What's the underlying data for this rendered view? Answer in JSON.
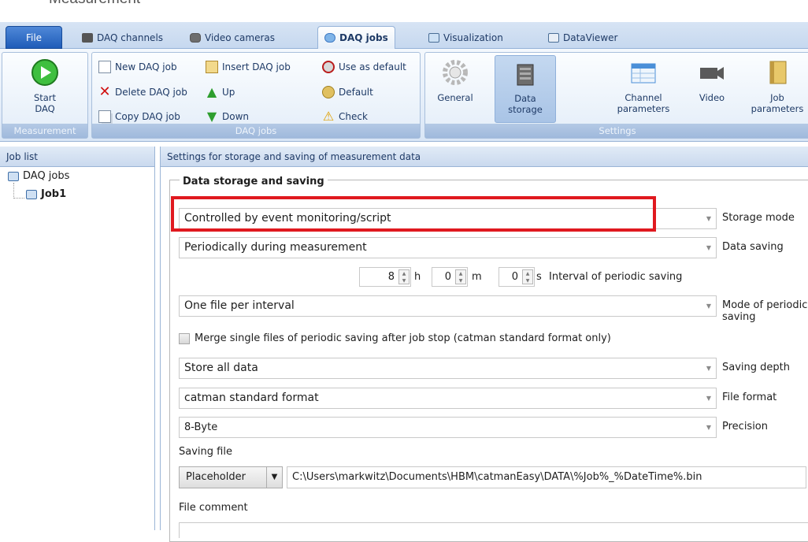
{
  "top_caption": "Measurement",
  "tabs": [
    {
      "label": "File",
      "icon": "file-menu"
    },
    {
      "label": "DAQ channels",
      "icon": "daq-channels-icon"
    },
    {
      "label": "Video cameras",
      "icon": "video-camera-icon"
    },
    {
      "label": "DAQ jobs",
      "icon": "daq-jobs-icon",
      "active": true
    },
    {
      "label": "Visualization",
      "icon": "visualization-icon"
    },
    {
      "label": "DataViewer",
      "icon": "dataviewer-icon"
    }
  ],
  "ribbon": {
    "measurement": {
      "start_label_1": "Start",
      "start_label_2": "DAQ",
      "group_title": "Measurement"
    },
    "daq_jobs": {
      "new": "New DAQ job",
      "insert": "Insert DAQ job",
      "use_default": "Use as default",
      "delete": "Delete DAQ job",
      "up": "Up",
      "default": "Default",
      "copy": "Copy DAQ job",
      "down": "Down",
      "check": "Check",
      "group_title": "DAQ jobs"
    },
    "settings": {
      "general": "General",
      "data_storage_1": "Data",
      "data_storage_2": "storage",
      "channel_params_1": "Channel",
      "channel_params_2": "parameters",
      "video": "Video",
      "job_params_1": "Job",
      "job_params_2": "parameters",
      "group_title": "Settings"
    }
  },
  "left_panel": {
    "title": "Job list",
    "root": "DAQ jobs",
    "job": "Job1"
  },
  "right_panel": {
    "title": "Settings for storage and saving of measurement data",
    "group_legend": "Data storage and saving",
    "storage_mode": {
      "value": "Controlled by event monitoring/script",
      "label": "Storage mode"
    },
    "data_saving": {
      "value": "Periodically during measurement",
      "label": "Data saving"
    },
    "interval": {
      "hours": "8",
      "h": "h",
      "minutes": "0",
      "m": "m",
      "seconds": "0",
      "s": "s",
      "label": "Interval of periodic saving"
    },
    "periodic_mode": {
      "value": "One file per interval",
      "label": "Mode of periodic saving"
    },
    "merge_checkbox": {
      "label": "Merge single files of periodic saving after job stop (catman standard format only)",
      "checked": false
    },
    "saving_depth": {
      "value": "Store all data",
      "label": "Saving depth"
    },
    "file_format": {
      "value": "catman standard format",
      "label": "File format"
    },
    "precision": {
      "value": "8-Byte",
      "label": "Precision"
    },
    "saving_file": {
      "label": "Saving file",
      "placeholder_button": "Placeholder",
      "path": "C:\\Users\\markwitz\\Documents\\HBM\\catmanEasy\\DATA\\%Job%_%DateTime%.bin"
    },
    "file_comment": {
      "label": "File comment"
    }
  },
  "colors": {
    "highlight": "#e0191f",
    "accent": "#1f5cb8"
  }
}
